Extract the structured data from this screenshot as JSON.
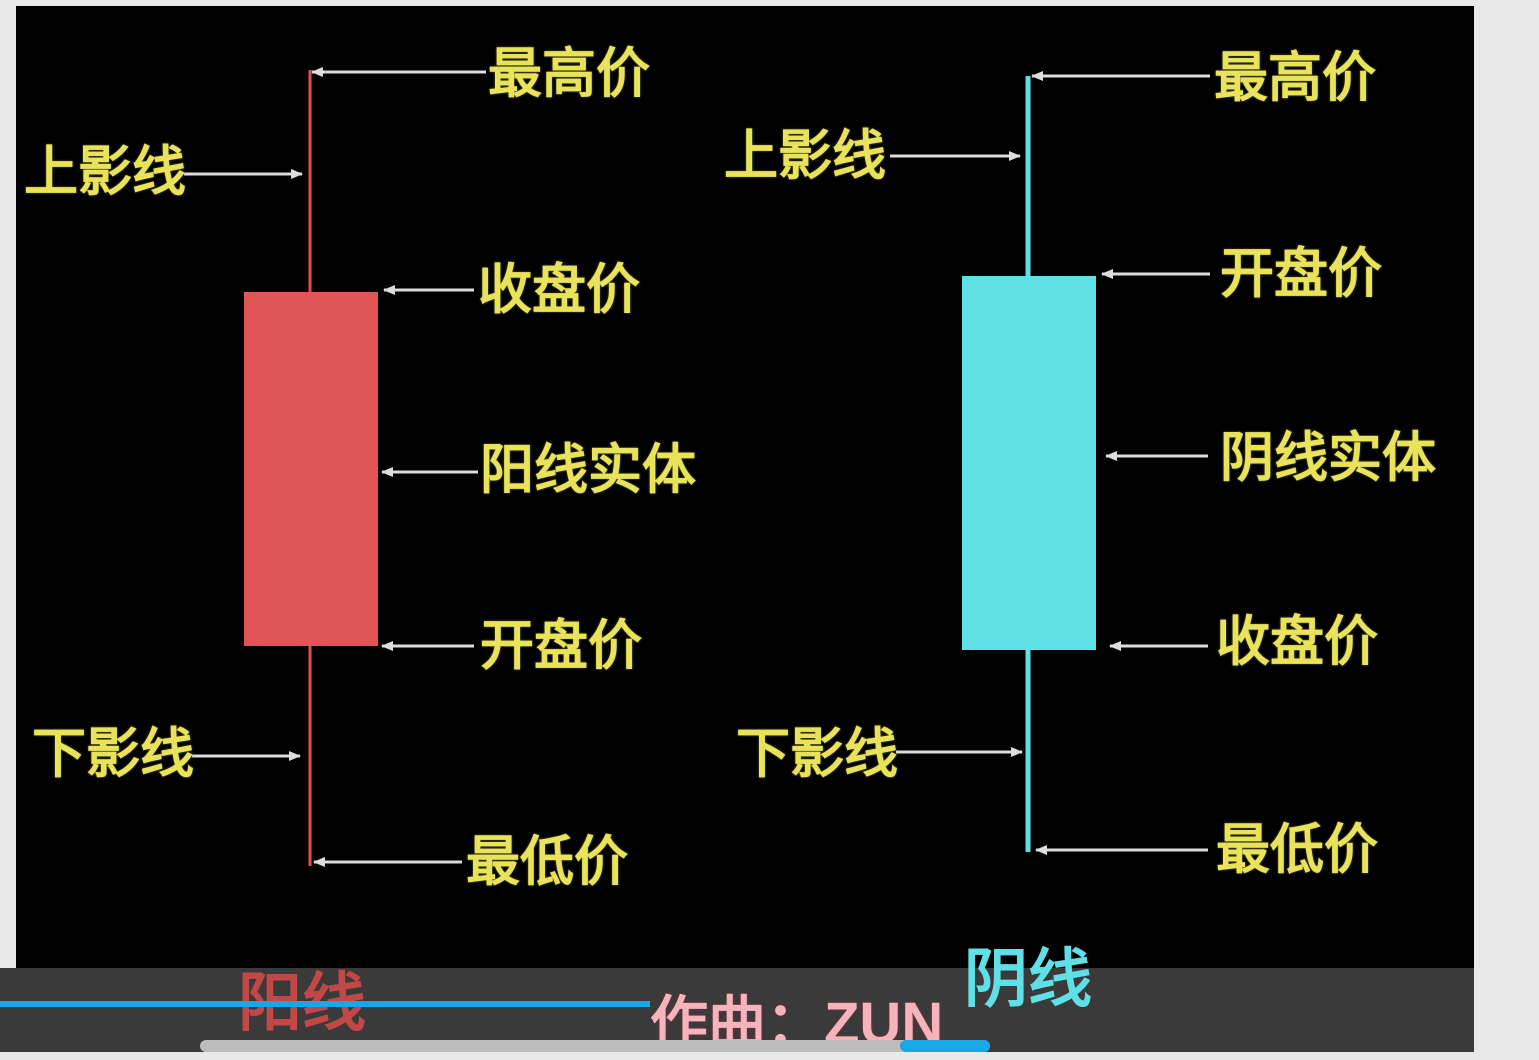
{
  "yang": {
    "title": "阳线",
    "color": "#e05555",
    "labels": {
      "high": "最高价",
      "upper_shadow": "上影线",
      "close": "收盘价",
      "body": "阳线实体",
      "open": "开盘价",
      "lower_shadow": "下影线",
      "low": "最低价"
    }
  },
  "yin": {
    "title": "阴线",
    "color": "#5ee0e6",
    "labels": {
      "high": "最高价",
      "upper_shadow": "上影线",
      "open": "开盘价",
      "body": "阴线实体",
      "close": "收盘价",
      "lower_shadow": "下影线",
      "low": "最低价"
    }
  },
  "label_color": "#e8e35a",
  "subtitle": "作曲：ZUN"
}
